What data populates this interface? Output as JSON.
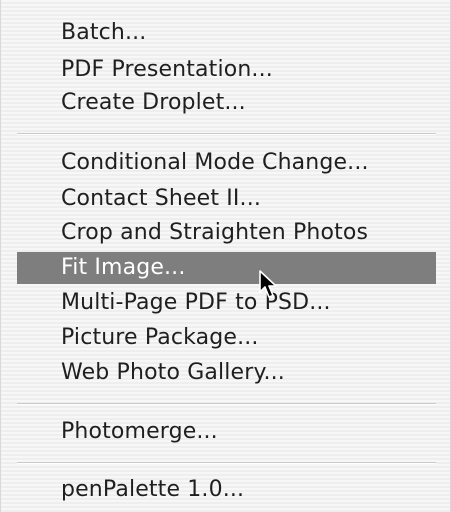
{
  "menu": {
    "groups": [
      {
        "items": [
          {
            "label": "Batch..."
          },
          {
            "label": "PDF Presentation..."
          },
          {
            "label": "Create Droplet..."
          }
        ]
      },
      {
        "items": [
          {
            "label": "Conditional Mode Change..."
          },
          {
            "label": "Contact Sheet II..."
          },
          {
            "label": "Crop and Straighten Photos"
          },
          {
            "label": "Fit Image...",
            "highlighted": true
          },
          {
            "label": "Multi-Page PDF to PSD..."
          },
          {
            "label": "Picture Package..."
          },
          {
            "label": "Web Photo Gallery..."
          }
        ]
      },
      {
        "items": [
          {
            "label": "Photomerge..."
          }
        ]
      },
      {
        "items": [
          {
            "label": "penPalette 1.0..."
          }
        ]
      }
    ]
  },
  "cursor": {
    "icon": "arrow-pointer-icon"
  },
  "colors": {
    "highlight": "#7e7e7e",
    "highlight_text": "#ffffff",
    "text": "#1f1f1f",
    "separator": "#c9c9c9"
  }
}
